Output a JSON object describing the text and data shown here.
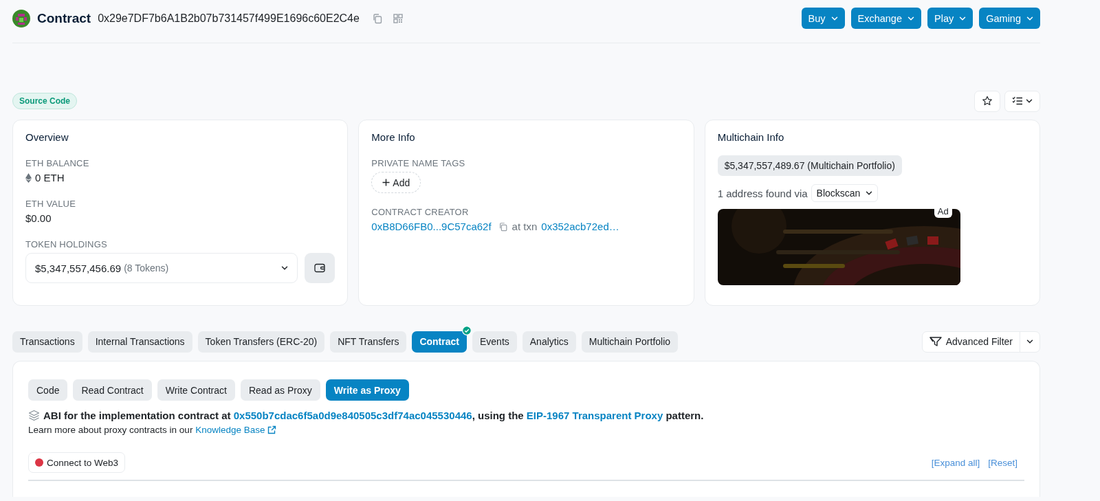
{
  "header": {
    "title": "Contract",
    "address": "0x29e7DF7b6A1B2b07b731457f499E1696c60E2C4e",
    "nav_buttons": [
      {
        "label": "Buy"
      },
      {
        "label": "Exchange"
      },
      {
        "label": "Play"
      },
      {
        "label": "Gaming"
      }
    ]
  },
  "source_code_badge": "Source Code",
  "overview": {
    "title": "Overview",
    "fields": [
      {
        "kind": "balance",
        "label": "ETH BALANCE",
        "value": "0 ETH"
      },
      {
        "kind": "text",
        "label": "ETH VALUE",
        "value": "$0.00"
      },
      {
        "kind": "holdings",
        "label": "TOKEN HOLDINGS",
        "value": "$5,347,557,456.69",
        "count": "(8 Tokens)"
      }
    ]
  },
  "more_info": {
    "title": "More Info",
    "private_name_tags": {
      "label": "PRIVATE NAME TAGS",
      "button": "Add"
    },
    "contract_creator": {
      "label": "CONTRACT CREATOR",
      "address": "0xB8D66FB0...9C57ca62f",
      "at_txn": "at txn",
      "txn": "0x352acb72ed…"
    }
  },
  "multichain_info": {
    "title": "Multichain Info",
    "portfolio_value": "$5,347,557,489.67",
    "portfolio_label": "(Multichain Portfolio)",
    "found_text": "1 address found via",
    "source_select": "Blockscan",
    "ad": {
      "badge": "Ad",
      "kind": "picture"
    }
  },
  "tabs": [
    {
      "label": "Transactions",
      "selected": false,
      "verified": false
    },
    {
      "label": "Internal Transactions",
      "selected": false,
      "verified": false
    },
    {
      "label": "Token Transfers (ERC-20)",
      "selected": false,
      "verified": false
    },
    {
      "label": "NFT Transfers",
      "selected": false,
      "verified": false
    },
    {
      "label": "Contract",
      "selected": true,
      "verified": true
    },
    {
      "label": "Events",
      "selected": false,
      "verified": false
    },
    {
      "label": "Analytics",
      "selected": false,
      "verified": false
    },
    {
      "label": "Multichain Portfolio",
      "selected": false,
      "verified": false
    }
  ],
  "advanced_filter": "Advanced Filter",
  "contract_tabs": [
    {
      "label": "Code",
      "selected": false
    },
    {
      "label": "Read Contract",
      "selected": false
    },
    {
      "label": "Write Contract",
      "selected": false
    },
    {
      "label": "Read as Proxy",
      "selected": false
    },
    {
      "label": "Write as Proxy",
      "selected": true
    }
  ],
  "abi_notice": {
    "prefix": "ABI for the implementation contract at",
    "implementation": "0x550b7cdac6f5a0d9e840505c3df74ac045530446",
    "middle": ", using the",
    "standard": "EIP-1967 Transparent Proxy",
    "suffix": "pattern."
  },
  "learn_more": {
    "text": "Learn more about proxy contracts in our",
    "link": "Knowledge Base"
  },
  "connect_button": {
    "label": "Connect to Web3",
    "connected": false
  },
  "expand_all": "[Expand all]",
  "reset": "[Reset]"
}
